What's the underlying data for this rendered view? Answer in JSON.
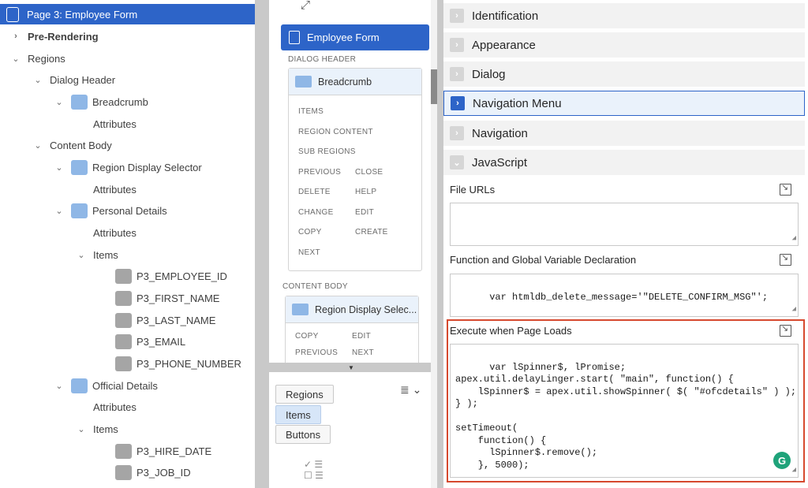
{
  "tree": {
    "rows": [
      {
        "label": "Page 3: Employee Form",
        "toggle": "",
        "icon": "page-icon"
      },
      {
        "label": "Pre-Rendering",
        "toggle": "›",
        "icon": ""
      },
      {
        "label": "Regions",
        "toggle": "⌄",
        "icon": ""
      },
      {
        "label": "Dialog Header",
        "toggle": "⌄",
        "icon": ""
      },
      {
        "label": "Breadcrumb",
        "toggle": "⌄",
        "icon": "breadcrumb-icon"
      },
      {
        "label": "Attributes",
        "toggle": "",
        "icon": ""
      },
      {
        "label": "Content Body",
        "toggle": "⌄",
        "icon": ""
      },
      {
        "label": "Region Display Selector",
        "toggle": "⌄",
        "icon": "region-display-selector-icon"
      },
      {
        "label": "Attributes",
        "toggle": "",
        "icon": ""
      },
      {
        "label": "Personal Details",
        "toggle": "⌄",
        "icon": "form-region-icon"
      },
      {
        "label": "Attributes",
        "toggle": "",
        "icon": ""
      },
      {
        "label": "Items",
        "toggle": "⌄",
        "icon": ""
      },
      {
        "label": "P3_EMPLOYEE_ID",
        "toggle": "",
        "icon": "hidden-item-icon"
      },
      {
        "label": "P3_FIRST_NAME",
        "toggle": "",
        "icon": "text-field-icon"
      },
      {
        "label": "P3_LAST_NAME",
        "toggle": "",
        "icon": "text-field-icon"
      },
      {
        "label": "P3_EMAIL",
        "toggle": "",
        "icon": "text-field-icon"
      },
      {
        "label": "P3_PHONE_NUMBER",
        "toggle": "",
        "icon": "text-field-icon"
      },
      {
        "label": "Official Details",
        "toggle": "⌄",
        "icon": "code-region-icon"
      },
      {
        "label": "Attributes",
        "toggle": "",
        "icon": ""
      },
      {
        "label": "Items",
        "toggle": "⌄",
        "icon": ""
      },
      {
        "label": "P3_HIRE_DATE",
        "toggle": "",
        "icon": "date-picker-icon"
      },
      {
        "label": "P3_JOB_ID",
        "toggle": "",
        "icon": "text-field-icon"
      }
    ]
  },
  "layout_panel": {
    "page_title": "Employee Form",
    "dialog_header_label": "DIALOG HEADER",
    "breadcrumb_card": {
      "title": "Breadcrumb",
      "links": [
        "ITEMS",
        "REGION CONTENT",
        "SUB REGIONS",
        "PREVIOUS",
        "CLOSE",
        "DELETE",
        "HELP",
        "CHANGE",
        "EDIT",
        "COPY",
        "CREATE",
        "NEXT"
      ]
    },
    "content_body_label": "CONTENT BODY",
    "region_card": {
      "title": "Region Display Selec...",
      "links": [
        "COPY",
        "EDIT",
        "PREVIOUS",
        "NEXT"
      ]
    },
    "gallery_tabs": [
      "Regions",
      "Items",
      "Buttons"
    ],
    "active_tab": "Items",
    "menu_glyph": "≣ ⌄"
  },
  "properties": {
    "groups": [
      "Identification",
      "Appearance",
      "Dialog",
      "Navigation Menu",
      "Navigation",
      "JavaScript"
    ],
    "file_urls_label": "File URLs",
    "file_urls_value": "",
    "func_label": "Function and Global Variable Declaration",
    "func_value": "var htmldb_delete_message='\"DELETE_CONFIRM_MSG\"';",
    "onload_label": "Execute when Page Loads",
    "onload_value": "var lSpinner$, lPromise;\napex.util.delayLinger.start( \"main\", function() {\n    lSpinner$ = apex.util.showSpinner( $( \"#ofcdetails\" ) );\n} );\n\nsetTimeout(\n    function() {\n      lSpinner$.remove();\n    }, 5000);",
    "grammarly_badge": "G"
  }
}
